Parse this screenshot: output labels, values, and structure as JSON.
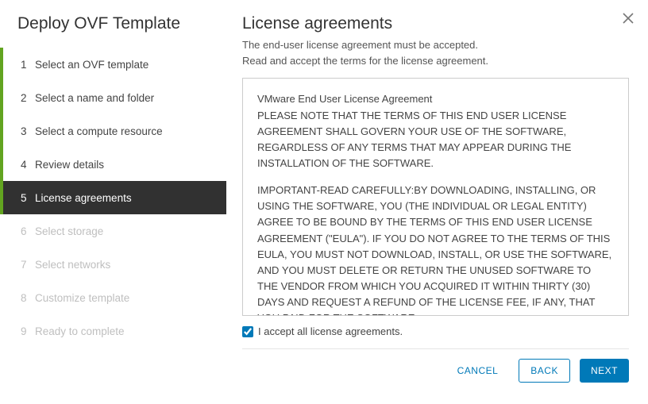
{
  "wizard": {
    "title": "Deploy OVF Template",
    "steps": [
      {
        "num": "1",
        "label": "Select an OVF template",
        "state": "done"
      },
      {
        "num": "2",
        "label": "Select a name and folder",
        "state": "done"
      },
      {
        "num": "3",
        "label": "Select a compute resource",
        "state": "done"
      },
      {
        "num": "4",
        "label": "Review details",
        "state": "done"
      },
      {
        "num": "5",
        "label": "License agreements",
        "state": "current"
      },
      {
        "num": "6",
        "label": "Select storage",
        "state": "future"
      },
      {
        "num": "7",
        "label": "Select networks",
        "state": "future"
      },
      {
        "num": "8",
        "label": "Customize template",
        "state": "future"
      },
      {
        "num": "9",
        "label": "Ready to complete",
        "state": "future"
      }
    ]
  },
  "page": {
    "title": "License agreements",
    "sub1": "The end-user license agreement must be accepted.",
    "sub2": "Read and accept the terms for the license agreement.",
    "license_p1": "VMware End User License Agreement",
    "license_p2": "PLEASE NOTE THAT THE TERMS OF THIS END USER LICENSE AGREEMENT SHALL GOVERN YOUR USE OF THE SOFTWARE, REGARDLESS OF ANY TERMS THAT MAY APPEAR DURING THE INSTALLATION OF THE SOFTWARE.",
    "license_p3": "IMPORTANT-READ CAREFULLY:BY DOWNLOADING, INSTALLING, OR USING THE SOFTWARE, YOU (THE INDIVIDUAL OR LEGAL ENTITY) AGREE TO BE BOUND BY THE TERMS OF THIS END USER LICENSE AGREEMENT (\"EULA\"). IF YOU DO NOT AGREE TO THE TERMS OF THIS EULA, YOU MUST NOT DOWNLOAD, INSTALL, OR USE THE SOFTWARE, AND YOU MUST DELETE OR RETURN THE UNUSED SOFTWARE TO THE VENDOR FROM WHICH YOU ACQUIRED IT WITHIN THIRTY (30) DAYS AND REQUEST A REFUND OF THE LICENSE FEE, IF ANY, THAT YOU PAID FOR THE SOFTWARE.",
    "accept_label": "I accept all license agreements.",
    "accept_checked": true
  },
  "footer": {
    "cancel": "CANCEL",
    "back": "BACK",
    "next": "NEXT"
  }
}
